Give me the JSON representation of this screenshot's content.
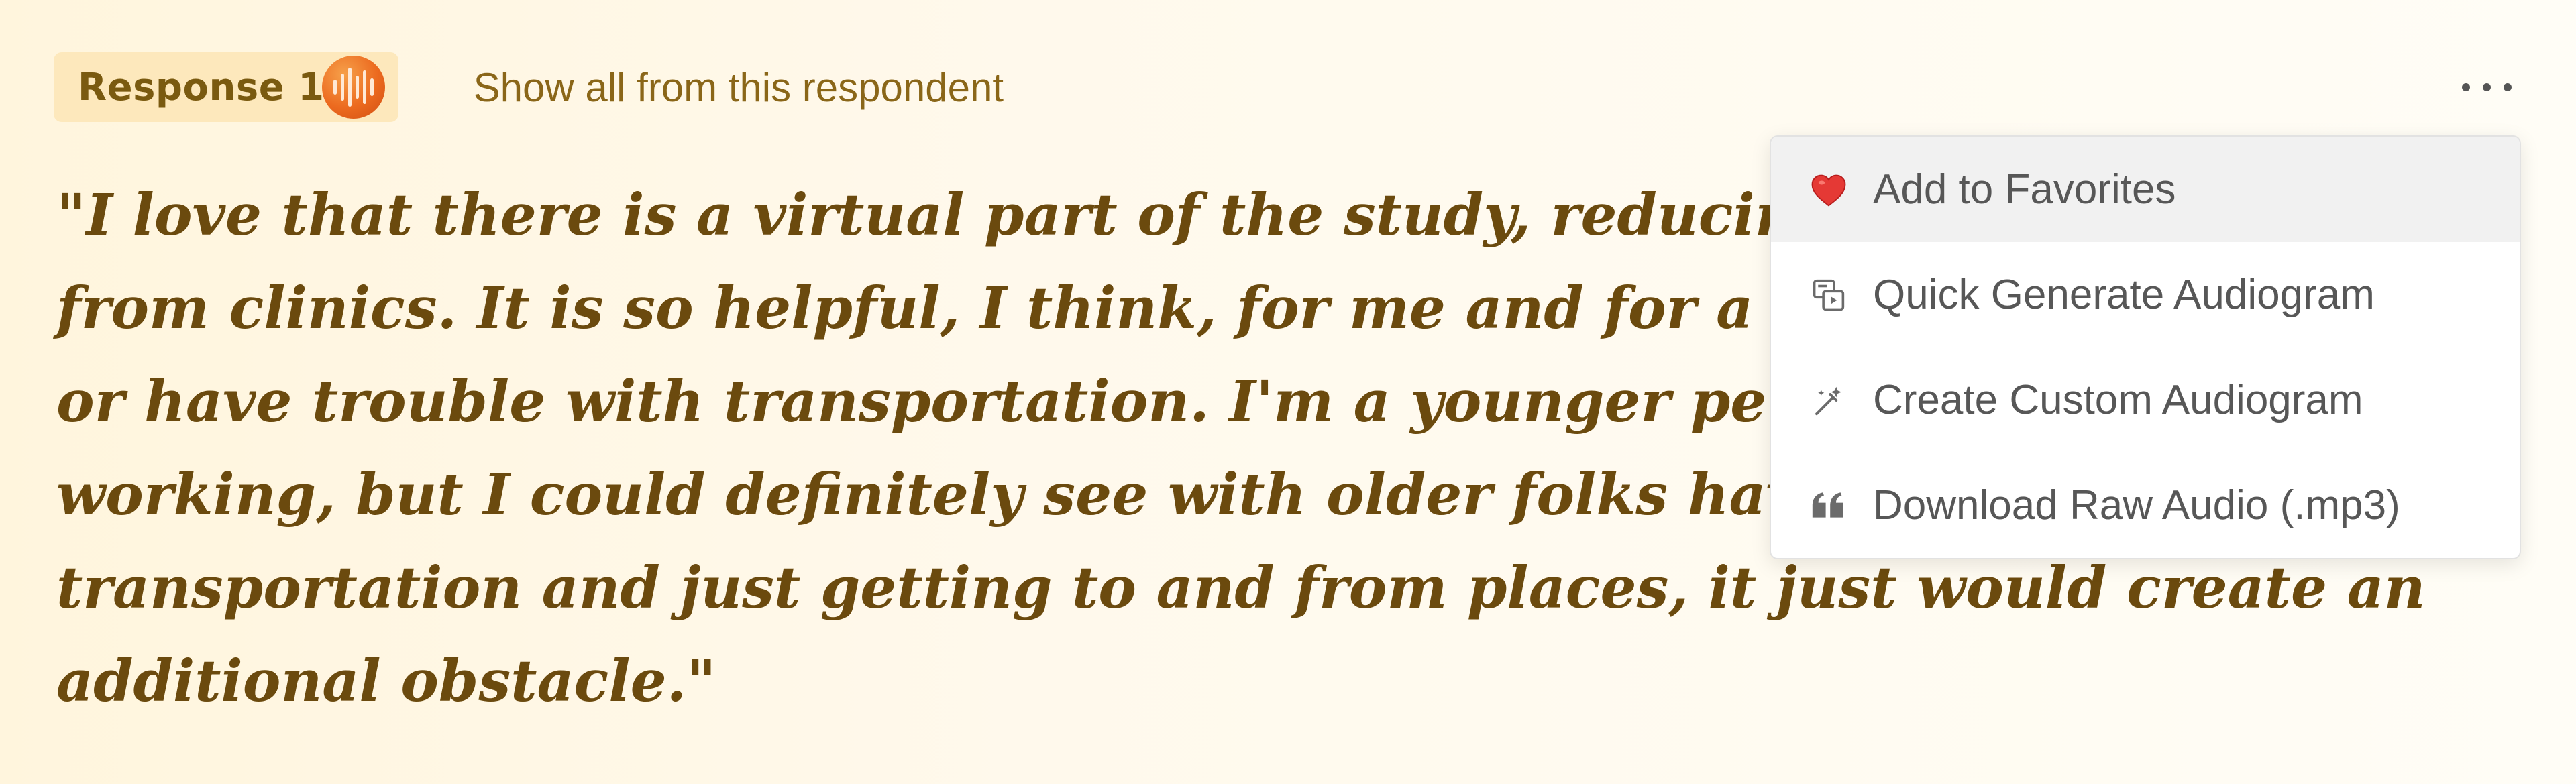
{
  "header": {
    "response_label": "Response 1",
    "show_all_label": "Show all from this respondent",
    "audio_icon": "audio-waveform-icon",
    "more_icon": "more-horizontal-icon"
  },
  "quote": {
    "lines": [
      "\"I love that there is a virtual part of the study, reducing t",
      "from clinics. It is so helpful, I think, for me and for a ton o",
      "or have trouble with transportation. I'm a younger person,",
      "working, but I could definitely see with older folks having",
      "transportation and just getting to and from places, it just would create an",
      "additional obstacle.\""
    ]
  },
  "menu": {
    "items": [
      {
        "label": "Add to Favorites",
        "icon": "heart-icon",
        "highlighted": true
      },
      {
        "label": "Quick Generate Audiogram",
        "icon": "audiogram-icon",
        "highlighted": false
      },
      {
        "label": "Create Custom Audiogram",
        "icon": "magic-wand-icon",
        "highlighted": false
      },
      {
        "label": "Download Raw Audio (.mp3)",
        "icon": "quote-icon",
        "highlighted": false
      }
    ]
  },
  "colors": {
    "quote_text": "#6b4a0e",
    "badge_bg": "#fde8bc",
    "badge_text": "#7a5a10",
    "link_text": "#8a6618",
    "audio_icon_bg": "#ec6a1f",
    "heart": "#e53935",
    "menu_text": "#575757"
  }
}
